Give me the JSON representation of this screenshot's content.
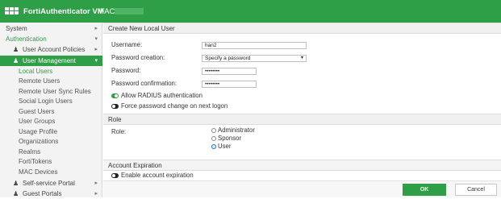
{
  "header": {
    "app_title": "FortiAuthenticator VM",
    "host_prefix": "FAC-"
  },
  "sidebar": {
    "system": "System",
    "authentication": "Authentication",
    "user_account_policies": "User Account Policies",
    "user_management": "User Management",
    "leaves": [
      "Local Users",
      "Remote Users",
      "Remote User Sync Rules",
      "Social Login Users",
      "Guest Users",
      "User Groups",
      "Usage Profile",
      "Organizations",
      "Realms",
      "FortiTokens",
      "MAC Devices"
    ],
    "self_service_portal": "Self-service Portal",
    "guest_portals": "Guest Portals"
  },
  "form": {
    "section_title": "Create New Local User",
    "username_label": "Username:",
    "username_value": "han2",
    "password_creation_label": "Password creation:",
    "password_creation_value": "Specify a password",
    "password_label": "Password:",
    "password_value": "••••••••",
    "confirm_label": "Password confirmation:",
    "confirm_value": "••••••••",
    "allow_radius": "Allow RADIUS authentication",
    "force_change": "Force password change on next logon"
  },
  "role": {
    "section_title": "Role",
    "label": "Role:",
    "options": [
      "Administrator",
      "Sponsor",
      "User"
    ],
    "selected": "User"
  },
  "expiration": {
    "section_title": "Account Expiration",
    "enable_label": "Enable account expiration"
  },
  "buttons": {
    "ok": "OK",
    "cancel": "Cancel"
  },
  "colors": {
    "brand": "#2e9e47",
    "radio_selected": "#1f6fd0"
  }
}
